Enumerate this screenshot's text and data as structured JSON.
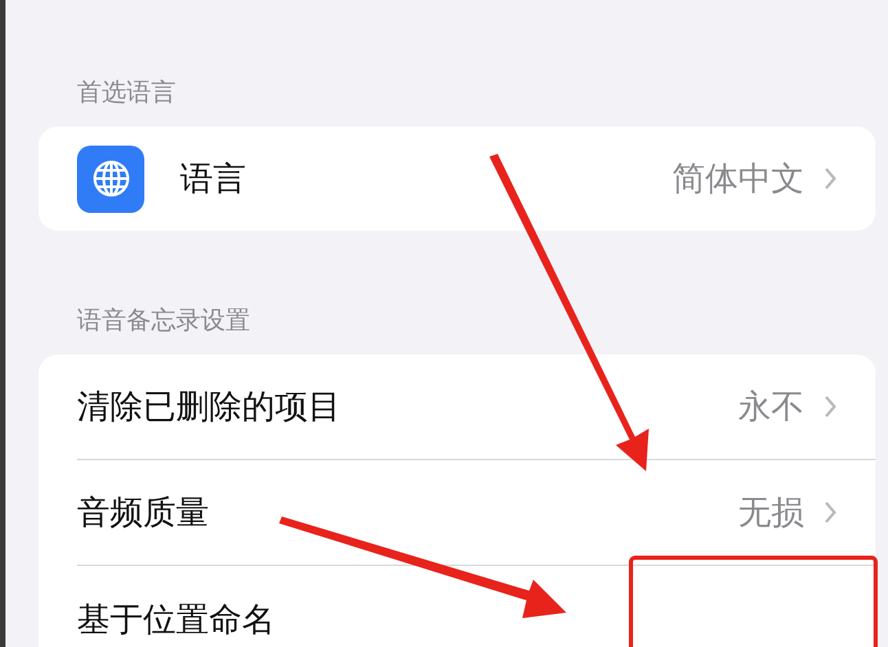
{
  "sections": [
    {
      "header": "首选语言",
      "rows": [
        {
          "kind": "icon",
          "label": "语言",
          "value": "简体中文"
        }
      ]
    },
    {
      "header": "语音备忘录设置",
      "rows": [
        {
          "kind": "plain",
          "label": "清除已删除的项目",
          "value": "永不"
        },
        {
          "kind": "plain",
          "label": "音频质量",
          "value": "无损"
        },
        {
          "kind": "plain",
          "label": "基于位置命名"
        }
      ]
    }
  ]
}
